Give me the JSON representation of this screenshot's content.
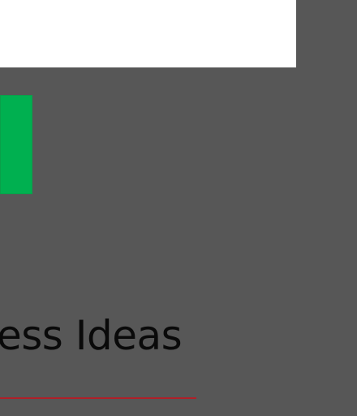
{
  "slide": {
    "title_fragment": "ess Ideas",
    "colors": {
      "background": "#575757",
      "green_block": "#00b050",
      "underline": "#b02028"
    }
  }
}
